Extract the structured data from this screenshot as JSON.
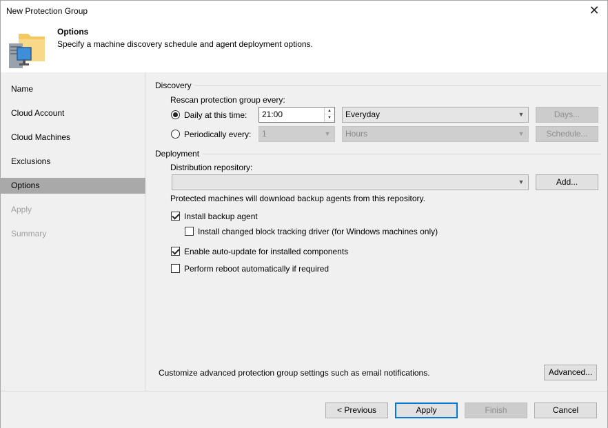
{
  "window": {
    "title": "New Protection Group"
  },
  "header": {
    "title": "Options",
    "subtitle": "Specify a machine discovery schedule and agent deployment options."
  },
  "sidebar": {
    "items": [
      {
        "label": "Name",
        "state": "normal"
      },
      {
        "label": "Cloud Account",
        "state": "normal"
      },
      {
        "label": "Cloud Machines",
        "state": "normal"
      },
      {
        "label": "Exclusions",
        "state": "normal"
      },
      {
        "label": "Options",
        "state": "active"
      },
      {
        "label": "Apply",
        "state": "disabled"
      },
      {
        "label": "Summary",
        "state": "disabled"
      }
    ]
  },
  "discovery": {
    "section_label": "Discovery",
    "rescan_label": "Rescan protection group every:",
    "daily_label": "Daily at this time:",
    "daily_time": "21:00",
    "daily_frequency": "Everyday",
    "days_button": "Days...",
    "periodically_label": "Periodically every:",
    "period_value": "1",
    "period_unit": "Hours",
    "schedule_button": "Schedule..."
  },
  "deployment": {
    "section_label": "Deployment",
    "repository_label": "Distribution repository:",
    "repository_value": "",
    "add_button": "Add...",
    "repository_note": "Protected machines will download backup agents from this repository.",
    "install_agent_label": "Install backup agent",
    "install_agent_checked": true,
    "cbt_label": "Install changed block tracking driver (for Windows machines only)",
    "cbt_checked": false,
    "auto_update_label": "Enable auto-update for installed components",
    "auto_update_checked": true,
    "reboot_label": "Perform reboot automatically if required",
    "reboot_checked": false
  },
  "advanced": {
    "note": "Customize advanced protection group settings such as email notifications.",
    "button": "Advanced..."
  },
  "footer": {
    "previous": "< Previous",
    "apply": "Apply",
    "finish": "Finish",
    "cancel": "Cancel"
  },
  "colors": {
    "active_nav": "#a9a9a9",
    "primary_border": "#0078d7",
    "folder": "#f5c862"
  }
}
